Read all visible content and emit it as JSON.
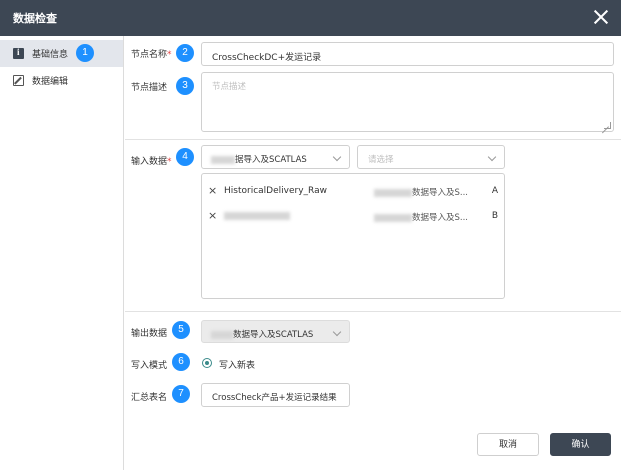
{
  "window": {
    "title": "数据检查"
  },
  "sidebar": {
    "items": [
      {
        "label": "基础信息",
        "icon": "info-icon",
        "active": true,
        "badge": "1"
      },
      {
        "label": "数据编辑",
        "icon": "edit-icon",
        "active": false
      }
    ]
  },
  "form": {
    "node_name": {
      "label": "节点名称",
      "required_mark": "*",
      "value": "CrossCheckDC+发运记录",
      "badge": "2"
    },
    "node_desc": {
      "label": "节点描述",
      "placeholder": "节点描述",
      "badge": "3"
    },
    "input_data": {
      "label": "输入数据",
      "required_mark": "*",
      "badge": "4",
      "select_source_value": "据导入及SCATLAS",
      "select_placeholder": "请选择",
      "rows": [
        {
          "name": "HistoricalDelivery_Raw",
          "source": "数据导入及S...",
          "tag": "A"
        },
        {
          "name": "",
          "source": "数据导入及S...",
          "tag": "B"
        }
      ]
    },
    "output_data": {
      "label": "输出数据",
      "badge": "5",
      "value": "数据导入及SCATLAS"
    },
    "write_mode": {
      "label": "写入模式",
      "badge": "6",
      "option": "写入新表"
    },
    "summary_table": {
      "label": "汇总表名",
      "badge": "7",
      "value": "CrossCheck产品+发运记录结果"
    }
  },
  "footer": {
    "cancel_label": "取消",
    "confirm_label": "确认"
  },
  "colors": {
    "header_bg": "#3d4754",
    "badge": "#1e90ff",
    "radio": "#3a8a8a",
    "active_sidebar": "#e3e6ec"
  }
}
